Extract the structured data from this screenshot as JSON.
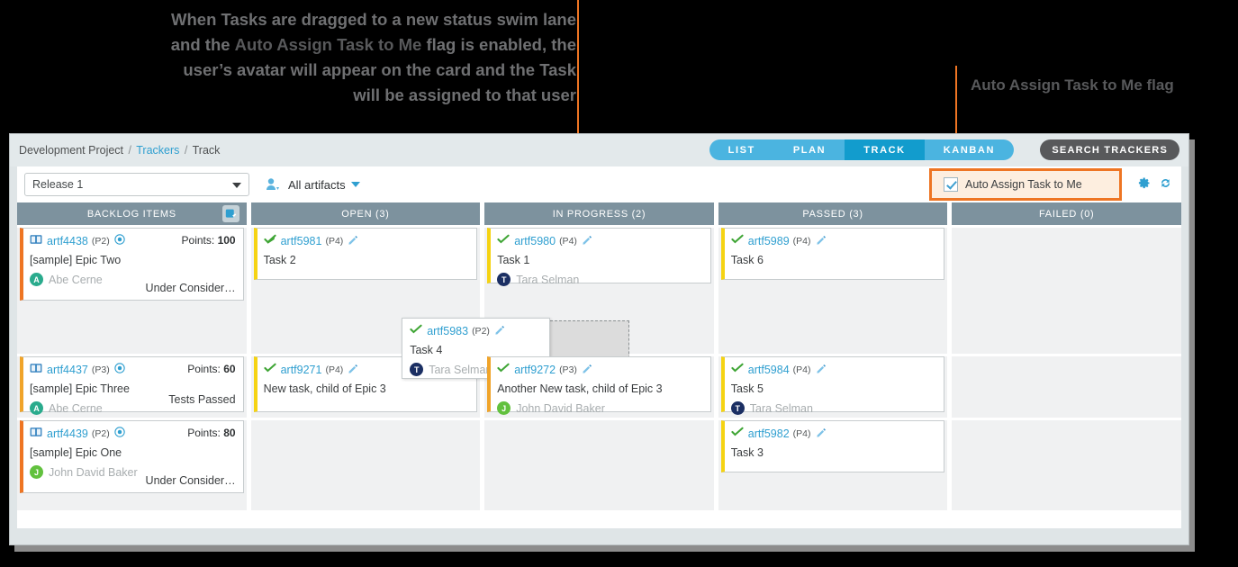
{
  "annotations": {
    "left_text_1": "When Tasks are dragged to a new status swim lane",
    "left_text_2a": "and the ",
    "left_text_2b": "Auto Assign Task to Me",
    "left_text_2c": " flag is enabled, the",
    "left_text_3": "user’s avatar will appear on the card and the Task",
    "left_text_4": "will be assigned to that user",
    "right_text": "Auto Assign Task to Me flag",
    "leader_color": "#ee7523"
  },
  "window": {
    "breadcrumb": {
      "project": "Development Project",
      "trackers": "Trackers",
      "current": "Track",
      "separator": "/"
    },
    "tabs": [
      {
        "label": "LIST",
        "active": false
      },
      {
        "label": "PLAN",
        "active": false
      },
      {
        "label": "TRACK",
        "active": true
      },
      {
        "label": "KANBAN",
        "active": false
      }
    ],
    "search_trackers_label": "SEARCH TRACKERS",
    "filter": {
      "release_value": "Release 1",
      "people_icon": "people-filter-icon",
      "artifacts_label": "All artifacts",
      "auto_assign_label": "Auto Assign Task to Me",
      "auto_assign_checked": true,
      "gear_icon": "gear-icon",
      "refresh_icon": "refresh-icon"
    }
  },
  "board": {
    "columns": [
      {
        "id": "backlog",
        "title": "BACKLOG ITEMS",
        "has_icon": true
      },
      {
        "id": "open",
        "title": "OPEN (3)",
        "has_icon": false
      },
      {
        "id": "inprogress",
        "title": "IN PROGRESS (2)",
        "has_icon": false
      },
      {
        "id": "passed",
        "title": "PASSED (3)",
        "has_icon": false
      },
      {
        "id": "failed",
        "title": "FAILED (0)",
        "has_icon": false
      }
    ],
    "cards": {
      "backlog_1": {
        "id": "artf4438",
        "priority": "(P2)",
        "title": "[sample] Epic Two",
        "assignee": "Abe Cerne",
        "avatar_letter": "A",
        "avatar_color": "#2aab8d",
        "points_label": "Points:",
        "points": "100",
        "status": "Under Consider…",
        "accent": "#ee7523",
        "icon": "book-icon"
      },
      "backlog_2": {
        "id": "artf4437",
        "priority": "(P3)",
        "title": "[sample] Epic Three",
        "assignee": "Abe Cerne",
        "avatar_letter": "A",
        "avatar_color": "#2aab8d",
        "points_label": "Points:",
        "points": "60",
        "status": "Tests Passed",
        "accent": "#f0a42a",
        "icon": "book-icon"
      },
      "backlog_3": {
        "id": "artf4439",
        "priority": "(P2)",
        "title": "[sample] Epic One",
        "assignee": "John David Baker",
        "avatar_letter": "J",
        "avatar_color": "#62c13e",
        "points_label": "Points:",
        "points": "80",
        "status": "Under Consider…",
        "accent": "#ee7523",
        "icon": "book-icon"
      },
      "open_1": {
        "id": "artf5981",
        "priority": "(P4)",
        "title": "Task 2",
        "assignee": "",
        "accent": "#f5d313",
        "icon": "check-icon",
        "edit_icon": "pencil-icon"
      },
      "open_2": {
        "id": "artf9271",
        "priority": "(P4)",
        "title": "New task, child of Epic 3",
        "assignee": "",
        "accent": "#f5d313",
        "icon": "check-icon",
        "edit_icon": "pencil-icon"
      },
      "inprogress_1": {
        "id": "artf5980",
        "priority": "(P4)",
        "title": "Task 1",
        "assignee": "Tara Selman",
        "avatar_letter": "T",
        "avatar_color": "#1b2f63",
        "accent": "#f5d313",
        "icon": "check-icon",
        "edit_icon": "pencil-icon"
      },
      "inprogress_2": {
        "id": "artf9272",
        "priority": "(P3)",
        "title": "Another New task, child of Epic 3",
        "assignee": "John David Baker",
        "avatar_letter": "J",
        "avatar_color": "#62c13e",
        "accent": "#f0a42a",
        "icon": "check-icon",
        "edit_icon": "pencil-icon"
      },
      "dragging": {
        "id": "artf5983",
        "priority": "(P2)",
        "title": "Task 4",
        "assignee": "Tara Selman",
        "avatar_letter": "T",
        "avatar_color": "#1b2f63",
        "icon": "check-icon",
        "edit_icon": "pencil-icon"
      },
      "passed_1": {
        "id": "artf5989",
        "priority": "(P4)",
        "title": "Task 6",
        "assignee": "",
        "accent": "#f5d313",
        "icon": "check-icon",
        "edit_icon": "pencil-icon"
      },
      "passed_2": {
        "id": "artf5984",
        "priority": "(P4)",
        "title": "Task 5",
        "assignee": "Tara Selman",
        "avatar_letter": "T",
        "avatar_color": "#1b2f63",
        "accent": "#f5d313",
        "icon": "check-icon",
        "edit_icon": "pencil-icon"
      },
      "passed_3": {
        "id": "artf5982",
        "priority": "(P4)",
        "title": "Task 3",
        "assignee": "",
        "accent": "#f5d313",
        "icon": "check-icon",
        "edit_icon": "pencil-icon"
      }
    },
    "drag_arrow_color": "#f7941e"
  }
}
